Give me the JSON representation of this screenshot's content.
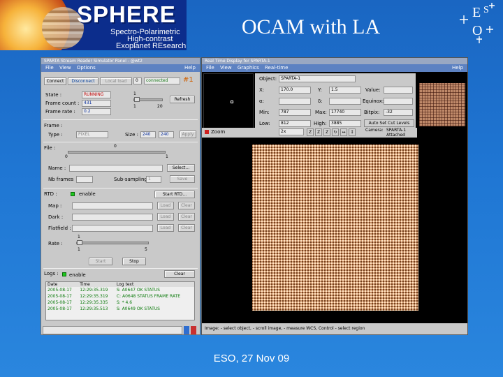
{
  "header": {
    "logo_word": "SPHERE",
    "logo_lines": [
      "Spectro-Polarimetric",
      "High-contrast",
      "Exoplanet REsearch"
    ],
    "title": "OCAM with LA",
    "eso_logo": "ESO"
  },
  "footer": "ESO, 27 Nov 09",
  "left_window": {
    "title": "SPARTA Stream Reader Simulator Panel - @wt2",
    "menu": [
      "File",
      "View",
      "Options"
    ],
    "menu_right": "Help",
    "connect_label": "Connect",
    "disconnect_label": "Disconnect",
    "local_label": "Local load",
    "counter": "0",
    "connected": "connected",
    "hash": "#1",
    "state_label": "State :",
    "state_value": "RUNNING",
    "frame_count_label": "Frame count :",
    "frame_count_value": "431",
    "frame_rate_label": "Frame rate :",
    "frame_rate_value": "0.2",
    "refresh_scale": [
      "1",
      "1",
      "20"
    ],
    "refresh_label": "Refresh",
    "frame_label": "Frame :",
    "type_label": "Type :",
    "type_value": "PIXEL",
    "size_label": "Size :",
    "size_w": "240",
    "size_h": "240",
    "apply_label": "Apply",
    "file_label": "File :",
    "file_scale": [
      "0",
      "0",
      "1"
    ],
    "name_label": "Name :",
    "select_label": "Select...",
    "nb_frames_label": "Nb frames",
    "subsampling_label": "Sub-sampling",
    "subsampling_value": "1",
    "save_label": "Save",
    "rtd_label": "RTD :",
    "rtd_enable": "enable",
    "start_rtd_label": "Start RTD...",
    "map_label": "Map :",
    "dark_label": "Dark :",
    "flatfield_label": "Flatfield :",
    "load_label": "Load",
    "clear_label": "Clear",
    "rate_label": "Rate :",
    "rate_scale": [
      "1",
      "1",
      "5"
    ],
    "start_label": "Start",
    "stop_label": "Stop",
    "logs_label": "Logs :",
    "logs_enable": "enable",
    "logs_clear": "Clear",
    "log_headers": [
      "Date",
      "Time",
      "Log text"
    ],
    "log_rows": [
      [
        "2005-08-17",
        "12:29:35.319",
        "S: A0647 OK STATUS"
      ],
      [
        "2005-08-17",
        "12:29:35.319",
        "C: A0648 STATUS FRAME RATE"
      ],
      [
        "2005-08-17",
        "12:29:35.335",
        "S: * 4.6"
      ],
      [
        "2005-08-17",
        "12:29:35.513",
        "S: A0649 OK STATUS"
      ]
    ]
  },
  "right_window": {
    "title": "Real Time Display for SPARTA-1",
    "menu": [
      "File",
      "View",
      "Graphics",
      "Real-time"
    ],
    "menu_right": "Help",
    "object_label": "Object:",
    "object_value": "SPARTA-1",
    "x_label": "X:",
    "x_value": "170.0",
    "y_label": "Y:",
    "y_value": "1.5",
    "value_label": "Value:",
    "a_label": "α:",
    "d_label": "δ:",
    "equinox_label": "Equinox:",
    "min_label": "Min:",
    "min_value": "787",
    "max_label": "Max:",
    "max_value": "17740",
    "bitpix_label": "Bitpix:",
    "bitpix_value": "-32",
    "low_label": "Low:",
    "low_value": "812",
    "high_label": "High:",
    "high_value": "3885",
    "autoset_label": "Auto Set Cut Levels",
    "zoom_label": "Zoom",
    "zoom_value": "2x",
    "camera_label": "Camera:",
    "camera_value": "SPARTA-1",
    "camera_state": "Attached",
    "status_text": "Image: - select object, - scroll image, - measure WCS, Control - select region"
  }
}
